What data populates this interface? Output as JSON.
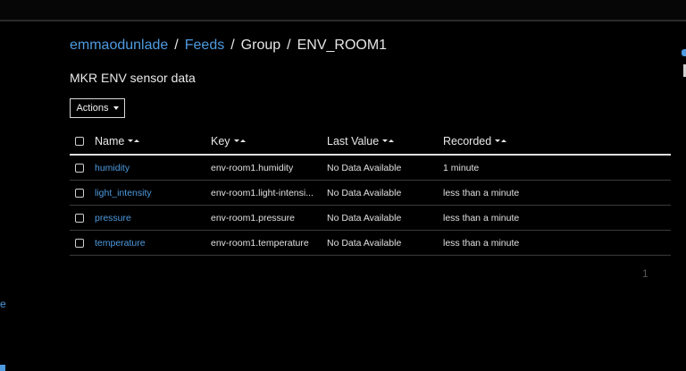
{
  "breadcrumb": {
    "user": "emmaodunlade",
    "feeds": "Feeds",
    "group": "Group",
    "current": "ENV_ROOM1",
    "separator": "/"
  },
  "description": "MKR ENV sensor data",
  "actions": {
    "label": "Actions"
  },
  "table": {
    "headers": {
      "name": "Name",
      "key": "Key",
      "last_value": "Last Value",
      "recorded": "Recorded"
    },
    "rows": [
      {
        "name": "humidity",
        "key": "env-room1.humidity",
        "last_value": "No Data Available",
        "recorded": "1 minute"
      },
      {
        "name": "light_intensity",
        "key": "env-room1.light-intensi...",
        "last_value": "No Data Available",
        "recorded": "less than a minute"
      },
      {
        "name": "pressure",
        "key": "env-room1.pressure",
        "last_value": "No Data Available",
        "recorded": "less than a minute"
      },
      {
        "name": "temperature",
        "key": "env-room1.temperature",
        "last_value": "No Data Available",
        "recorded": "less than a minute"
      }
    ]
  },
  "pagination": {
    "page": "1"
  },
  "side": {
    "left_fragment": "e"
  },
  "colors": {
    "background": "#000000",
    "link": "#4e9be0",
    "text": "#e6e6e6",
    "muted": "#555555"
  }
}
